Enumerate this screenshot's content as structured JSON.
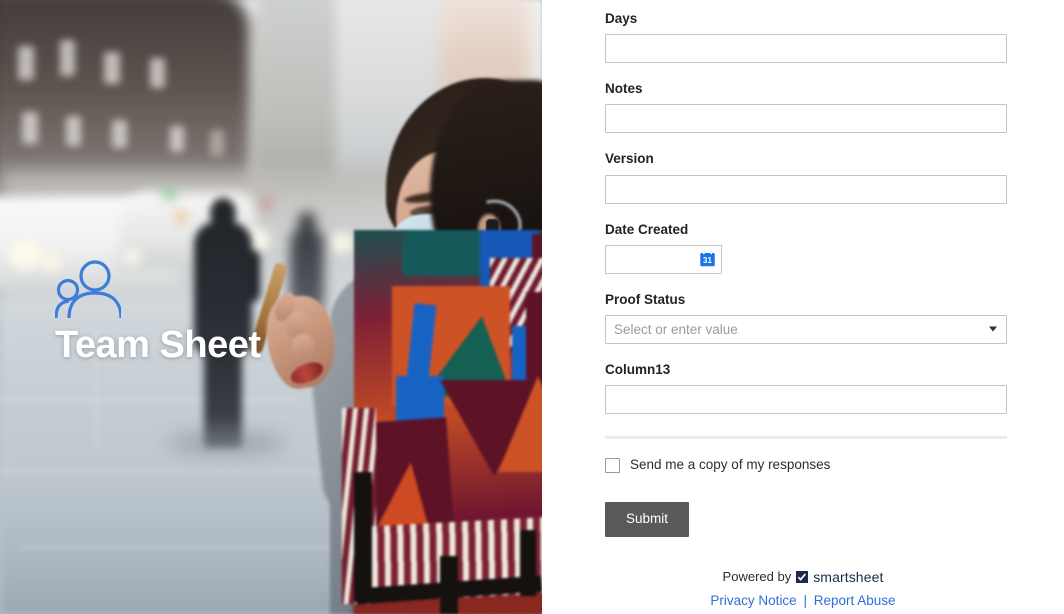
{
  "hero": {
    "title": "Team Sheet",
    "icon": "people-icon",
    "photo_description": "Blurred city street scene with a woman wearing a face mask and a geometric patterned scarf using a phone"
  },
  "form": {
    "fields": [
      {
        "label": "Days",
        "type": "text",
        "value": "",
        "placeholder": ""
      },
      {
        "label": "Notes",
        "type": "text",
        "value": "",
        "placeholder": ""
      },
      {
        "label": "Version",
        "type": "text",
        "value": "",
        "placeholder": ""
      },
      {
        "label": "Date Created",
        "type": "date",
        "value": "",
        "placeholder": ""
      },
      {
        "label": "Proof Status",
        "type": "select",
        "value": "",
        "placeholder": "Select or enter value"
      },
      {
        "label": "Column13",
        "type": "text",
        "value": "",
        "placeholder": ""
      }
    ],
    "copy_checkbox_label": "Send me a copy of my responses",
    "copy_checkbox_checked": false,
    "submit_label": "Submit"
  },
  "footer": {
    "powered_by": "Powered by",
    "brand": "smartsheet",
    "privacy_link": "Privacy Notice",
    "separator": "|",
    "report_link": "Report Abuse"
  },
  "colors": {
    "submit_bg": "#595959",
    "link": "#2f6fdb",
    "brand_navy": "#1b2a4a",
    "calendar_blue": "#1a73e8",
    "icon_blue": "#3b7dd8",
    "input_border": "#c4c4c4",
    "divider": "#ebebeb",
    "label_text": "#222326",
    "placeholder_text": "#9b9b9b"
  }
}
